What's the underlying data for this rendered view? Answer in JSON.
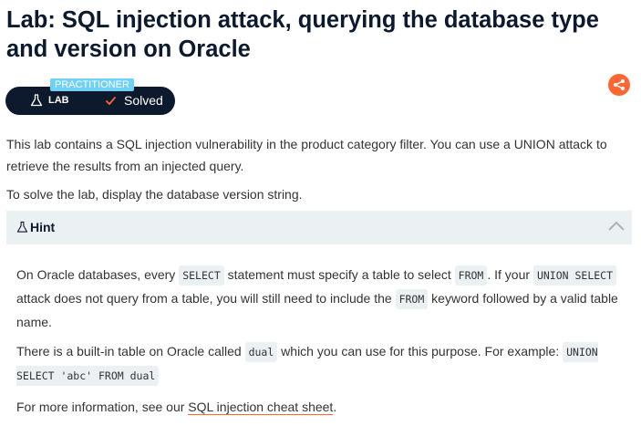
{
  "lab": {
    "title": "Lab: SQL injection attack, querying the database type and version on Oracle",
    "level": "PRACTITIONER",
    "type_label": "LAB",
    "status": "Solved"
  },
  "share": {
    "icon": "share-icon"
  },
  "description": {
    "p1": "This lab contains a SQL injection vulnerability in the product category filter. You can use a UNION attack to retrieve the results from an injected query.",
    "p2": "To solve the lab, display the database version string."
  },
  "hint": {
    "label": "Hint",
    "icon": "flask-icon",
    "toggle_icon": "chevron-up-icon",
    "p1": {
      "t1": "On Oracle databases, every ",
      "c1": "SELECT",
      "t2": " statement must specify a table to select ",
      "c2": "FROM",
      "t3": ". If your ",
      "c3": "UNION SELECT",
      "t4": " attack does not query from a table, you will still need to include the ",
      "c4": "FROM",
      "t5": " keyword followed by a valid table name."
    },
    "p2": {
      "t1": "There is a built-in table on Oracle called ",
      "c1": "dual",
      "t2": " which you can use for this purpose. For example: ",
      "c2": "UNION SELECT 'abc' FROM dual"
    },
    "p3": {
      "t1": "For more information, see our ",
      "link": "SQL injection cheat sheet",
      "t2": "."
    }
  },
  "colors": {
    "navy": "#0d1a2e",
    "accent": "#ff6633",
    "level": "#70d1f4",
    "hint_bg": "#ebf0f2"
  }
}
